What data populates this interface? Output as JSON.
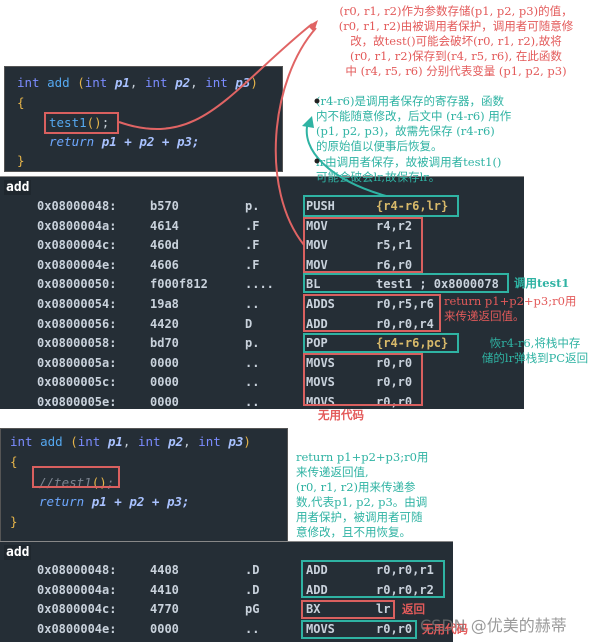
{
  "code_top": {
    "sig": {
      "kw1": "int",
      "name": "add",
      "open": "(",
      "kw2": "int",
      "p1": "p1",
      "c1": ",",
      "kw3": "int",
      "p2": "p2",
      "c2": ",",
      "kw4": "int",
      "p3": "p3",
      "close": ")"
    },
    "lbrace": "{",
    "call": {
      "name": "test1",
      "parens": "()",
      "semi": ";"
    },
    "ret": {
      "kw": "return",
      "expr": "p1 + p2 + p3;"
    },
    "rbrace": "}"
  },
  "asm_top": {
    "label": "add",
    "rows": [
      {
        "addr": "0x08000048:",
        "hex": "b570",
        "chars": "p.",
        "op": "PUSH",
        "args": "{r4-r6,lr}"
      },
      {
        "addr": "0x0800004a:",
        "hex": "4614",
        "chars": ".F",
        "op": "MOV",
        "args": "r4,r2"
      },
      {
        "addr": "0x0800004c:",
        "hex": "460d",
        "chars": ".F",
        "op": "MOV",
        "args": "r5,r1"
      },
      {
        "addr": "0x0800004e:",
        "hex": "4606",
        "chars": ".F",
        "op": "MOV",
        "args": "r6,r0"
      },
      {
        "addr": "0x08000050:",
        "hex": "f000f812",
        "chars": "....",
        "op": "BL",
        "args": "test1 ; 0x8000078"
      },
      {
        "addr": "0x08000054:",
        "hex": "19a8",
        "chars": "..",
        "op": "ADDS",
        "args": "r0,r5,r6"
      },
      {
        "addr": "0x08000056:",
        "hex": "4420",
        "chars": "D",
        "op": "ADD",
        "args": "r0,r0,r4"
      },
      {
        "addr": "0x08000058:",
        "hex": "bd70",
        "chars": "p.",
        "op": "POP",
        "args": "{r4-r6,pc}"
      },
      {
        "addr": "0x0800005a:",
        "hex": "0000",
        "chars": "..",
        "op": "MOVS",
        "args": "r0,r0"
      },
      {
        "addr": "0x0800005c:",
        "hex": "0000",
        "chars": "..",
        "op": "MOVS",
        "args": "r0,r0"
      },
      {
        "addr": "0x0800005e:",
        "hex": "0000",
        "chars": "..",
        "op": "MOVS",
        "args": "r0,r0"
      }
    ]
  },
  "code_bottom": {
    "sig": {
      "kw1": "int",
      "name": "add",
      "open": "(",
      "kw2": "int",
      "p1": "p1",
      "c1": ",",
      "kw3": "int",
      "p2": "p2",
      "c2": ",",
      "kw4": "int",
      "p3": "p3",
      "close": ")"
    },
    "lbrace": "{",
    "call": {
      "comment": "//test1",
      "parens": "()",
      "semi": ";"
    },
    "ret": {
      "kw": "return",
      "expr": "p1 + p2 + p3;"
    },
    "rbrace": "}"
  },
  "asm_bottom": {
    "label": "add",
    "rows": [
      {
        "addr": "0x08000048:",
        "hex": "4408",
        "chars": ".D",
        "op": "ADD",
        "args": "r0,r0,r1"
      },
      {
        "addr": "0x0800004a:",
        "hex": "4410",
        "chars": ".D",
        "op": "ADD",
        "args": "r0,r0,r2"
      },
      {
        "addr": "0x0800004c:",
        "hex": "4770",
        "chars": "pG",
        "op": "BX",
        "args": "lr"
      },
      {
        "addr": "0x0800004e:",
        "hex": "0000",
        "chars": "..",
        "op": "MOVS",
        "args": "r0,r0"
      }
    ]
  },
  "annotations": {
    "params_note": [
      "(r0, r1, r2)作为参数存储(p1, p2, p3)的值，",
      "(r0, r1, r2)由被调用者保护，调用者可随意修",
      "改，故test()可能会破坏(r0, r1, r2),故将",
      "(r0, r1, r2)保存到(r4, r5, r6),      在此函数",
      "中 (r4, r5, r6) 分别代表变量 (p1, p2, p3)"
    ],
    "bullet1": [
      "(r4-r6)是调用者保存的寄存器，函数",
      "内不能随意修改，后文中 (r4-r6) 用作",
      "(p1, p2, p3)，故需先保存 (r4-r6)",
      "的原始值以便事后恢复。"
    ],
    "bullet2": [
      "lr由调用者保存，故被调用者test1()",
      "可能会破会lr,故保存lr。"
    ],
    "call_test1": "调用test1",
    "return_note": [
      "return p1+p2+p3;r0用",
      "来传递返回值。"
    ],
    "pop_note": [
      "恢r4-r6,将栈中存",
      "储的lr弹栈到PC返回"
    ],
    "unused_top": "无用代码",
    "bottom_note": [
      "return p1+p2+p3;r0用",
      "来传递返回值,",
      "(r0, r1, r2)用来传递参",
      "数,代表p1, p2, p3。由调",
      "用者保护，被调用者可随",
      "意修改，且不用恢复。"
    ],
    "return_label": "返回",
    "unused_bottom": "无用代码",
    "watermark": "CSDN @优美的赫蒂"
  }
}
